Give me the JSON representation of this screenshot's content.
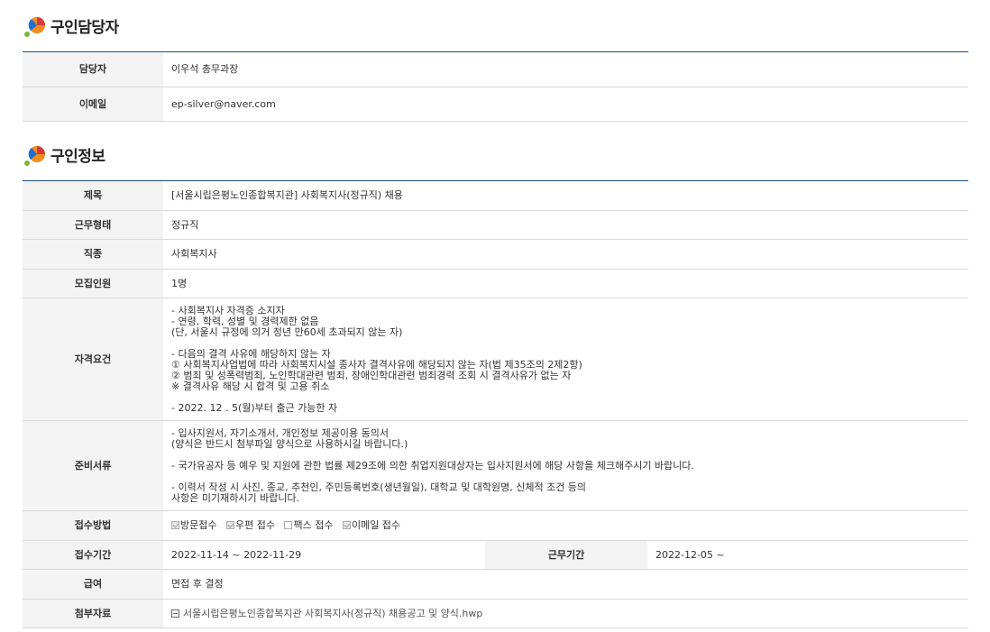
{
  "contact_section": {
    "title": "구인담당자",
    "rows": [
      {
        "label": "담당자",
        "value": "이우석 총무과장"
      },
      {
        "label": "이메일",
        "value": "ep-silver@naver.com"
      }
    ]
  },
  "job_section": {
    "title": "구인정보",
    "subject": {
      "label": "제목",
      "value": "[서울시립은평노인종합복지관] 사회복지사(정규직) 채용"
    },
    "work_type": {
      "label": "근무형태",
      "value": "정규직"
    },
    "occupation": {
      "label": "직종",
      "value": "사회복지사"
    },
    "headcount": {
      "label": "모집인원",
      "value": "1명"
    },
    "qualifications": {
      "label": "자격요건",
      "value": "- 사회복지사 자격증 소지자\n- 연령, 학력, 성별 및 경력제한 없음\n (단, 서울시 규정에 의거 정년 만60세 초과되지 않는 자)\n\n- 다음의 결격 사유에 해당하지 않는 자\n① 사회복지사업법에 따라 사회복지시설 종사자 결격사유에 해당되지 않는 자(법 제35조의 2제2항)\n② 범죄 및 성폭력범죄, 노인학대관련 범죄, 장애인학대관련 범죄경력 조회 시 결격사유가 없는 자\n※ 결격사유 해당 시 합격 및 고용 취소\n\n- 2022. 12 . 5(월)부터 출근 가능한 자"
    },
    "documents": {
      "label": "준비서류",
      "value": "- 입사지원서, 자기소개서, 개인정보 제공이용 동의서\n  (양식은 반드시 첨부파일 양식으로 사용하시길 바랍니다.)\n\n- 국가유공자 등 예우 및 지원에 관한 법률 제29조에 의한 취업지원대상자는 입사지원서에 해당 사항을 체크해주시기 바랍니다.\n\n- 이력서 작성 시 사진, 종교, 추천인, 주민등록번호(생년월일), 대학교 및 대학원명, 신체적 조건 등의\n  사항은 미기재하시기 바랍니다."
    },
    "apply_method": {
      "label": "접수방법",
      "options": [
        {
          "label": "방문접수",
          "checked": true
        },
        {
          "label": "우편 접수",
          "checked": true
        },
        {
          "label": "팩스 접수",
          "checked": false
        },
        {
          "label": "이메일 접수",
          "checked": true
        }
      ]
    },
    "apply_period": {
      "label": "접수기간",
      "value": "2022-11-14 ~ 2022-11-29"
    },
    "work_period": {
      "label": "근무기간",
      "value": "2022-12-05 ~"
    },
    "salary": {
      "label": "급여",
      "value": "면접 후 결정"
    },
    "attachment": {
      "label": "첨부자료",
      "value": "서울시립은평노인종합복지관 사회복지사(정규직) 채용공고 및 양식.hwp"
    }
  },
  "colors": {
    "header_border": "#1f4e79",
    "th_background": "#f3f3f3",
    "logo_orange": "#f28c1e",
    "logo_red": "#d83a3a",
    "logo_blue": "#1f6fd1",
    "logo_green": "#7bb531"
  }
}
